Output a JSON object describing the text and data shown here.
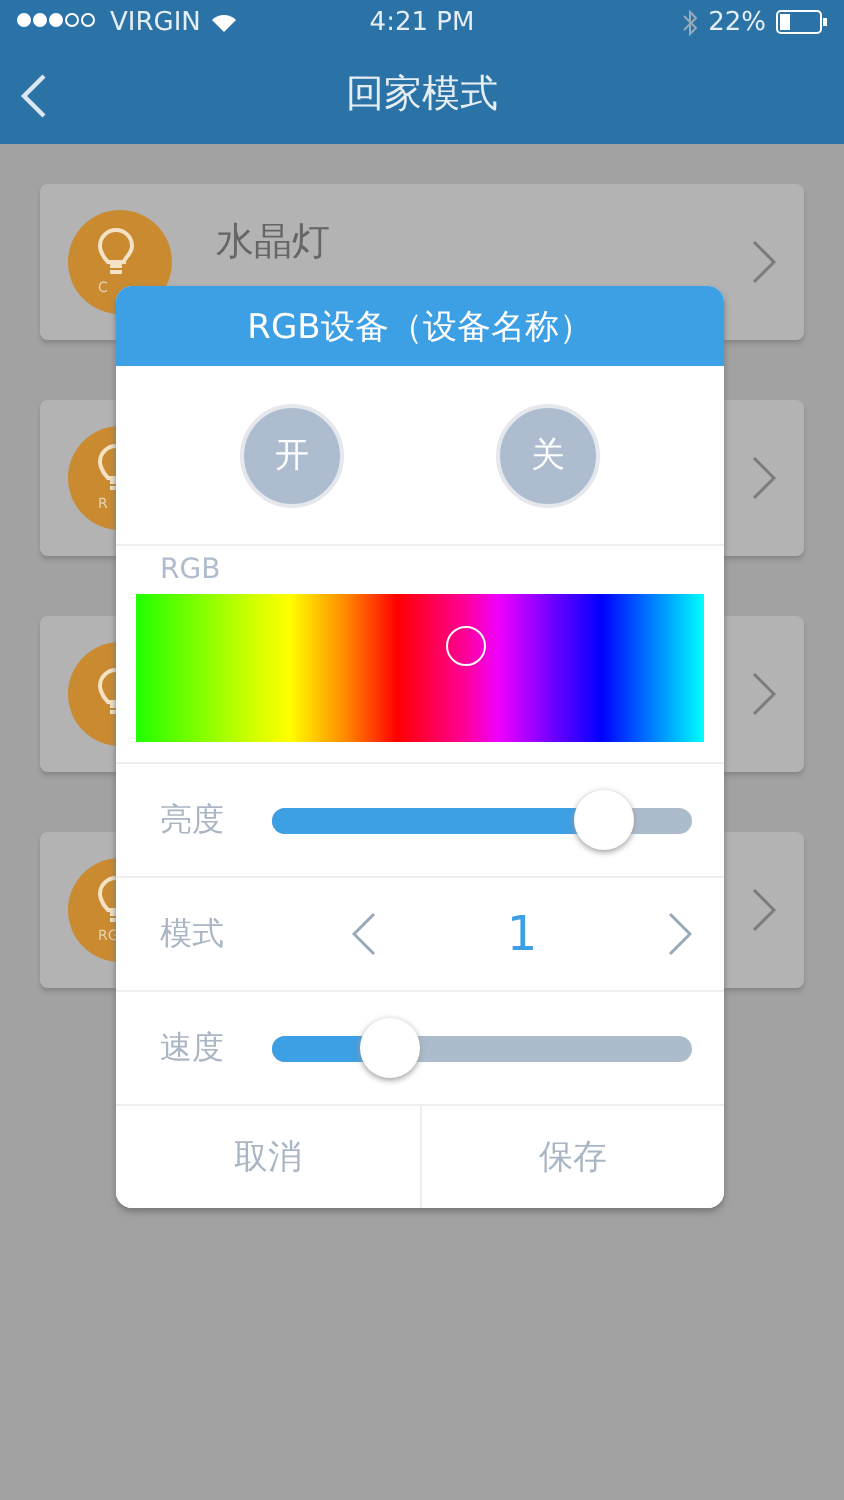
{
  "status_bar": {
    "carrier": "VIRGIN",
    "time": "4:21 PM",
    "battery": "22%"
  },
  "nav": {
    "title": "回家模式"
  },
  "devices": [
    {
      "kind": "lamp",
      "name": "水晶灯",
      "badge": "C"
    },
    {
      "kind": "lamp",
      "badge": "R"
    },
    {
      "kind": "lamp"
    },
    {
      "kind": "lamp",
      "badge": "RG"
    }
  ],
  "dialog": {
    "title": "RGB设备（设备名称）",
    "power_buttons": [
      "开",
      "关"
    ],
    "rgb": {
      "label": "RGB",
      "level": 0.58
    },
    "brightness": {
      "label": "亮度",
      "level": 0.79
    },
    "mode": {
      "label": "模式",
      "value": "1"
    },
    "speed": {
      "label": "速度",
      "level": 0.28
    },
    "buttons": [
      "取消",
      "保存"
    ]
  }
}
